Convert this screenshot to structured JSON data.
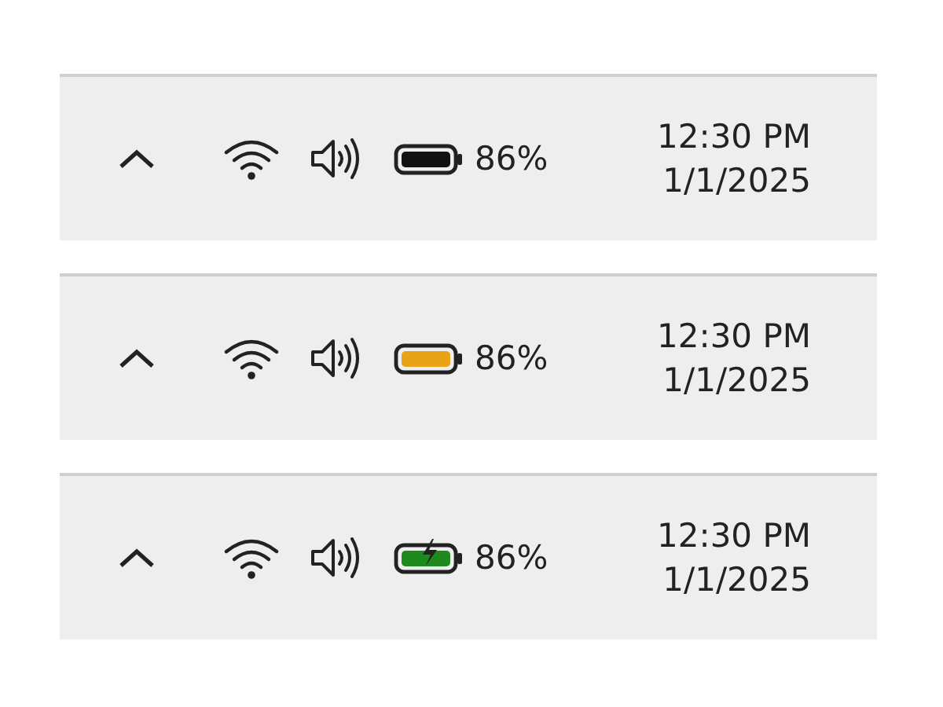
{
  "trays": [
    {
      "battery": {
        "kind": "normal"
      },
      "percent": "86%",
      "time": "12:30 PM",
      "date": "1/1/2025"
    },
    {
      "battery": {
        "kind": "saver"
      },
      "percent": "86%",
      "time": "12:30 PM",
      "date": "1/1/2025"
    },
    {
      "battery": {
        "kind": "charging"
      },
      "percent": "86%",
      "time": "12:30 PM",
      "date": "1/1/2025"
    }
  ]
}
